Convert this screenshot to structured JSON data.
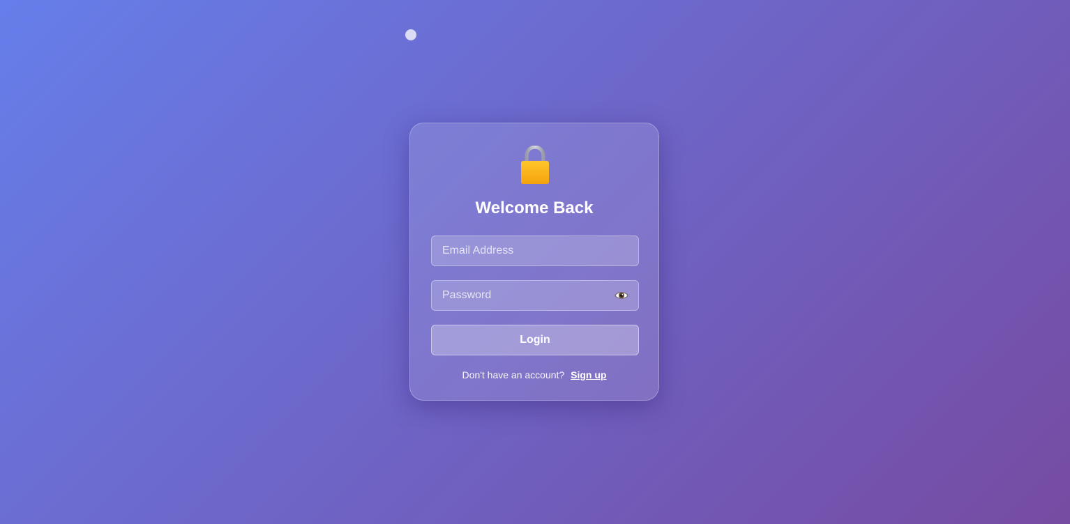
{
  "background": {
    "gradient_start": "#667eea",
    "gradient_end": "#764ba2"
  },
  "decoration": {
    "dot_icon": "circle-dot-icon"
  },
  "login_card": {
    "icon": "lock-icon",
    "title": "Welcome Back",
    "email": {
      "placeholder": "Email Address",
      "value": ""
    },
    "password": {
      "placeholder": "Password",
      "value": "",
      "toggle_icon": "eye-icon"
    },
    "login_label": "Login",
    "signup_prompt": "Don't have an account?",
    "signup_link": "Sign up"
  }
}
